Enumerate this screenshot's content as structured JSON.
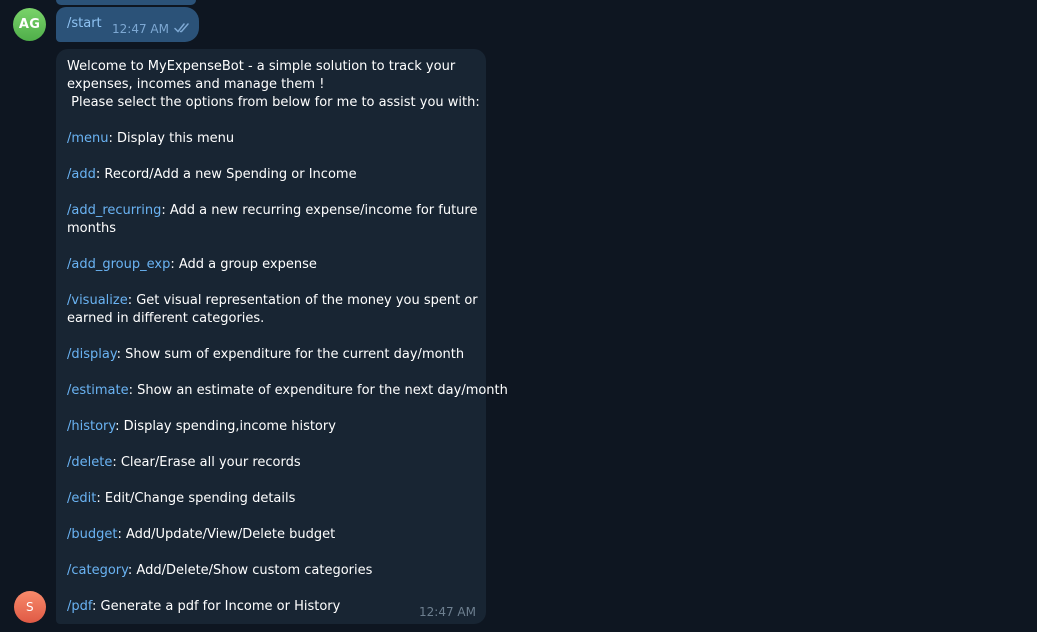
{
  "user_message": {
    "avatar_initials": "AG",
    "command": "/start",
    "time": "12:47 AM",
    "status_icon": "double-check-icon"
  },
  "bot_message": {
    "avatar_initials": "S",
    "intro_lines": [
      "Welcome to MyExpenseBot - a simple solution to track your",
      "expenses, incomes and manage them !",
      " Please select the options from below for me to assist you with:"
    ],
    "commands": [
      {
        "cmd": "/menu",
        "desc_lines": [
          ": Display this menu"
        ]
      },
      {
        "cmd": "/add",
        "desc_lines": [
          ": Record/Add a new Spending or Income"
        ]
      },
      {
        "cmd": "/add_recurring",
        "desc_lines": [
          ": Add a new recurring expense/income for future",
          "months"
        ]
      },
      {
        "cmd": "/add_group_exp",
        "desc_lines": [
          ": Add a group expense"
        ]
      },
      {
        "cmd": "/visualize",
        "desc_lines": [
          ": Get visual representation of the money you spent or",
          "earned in different categories."
        ]
      },
      {
        "cmd": "/display",
        "desc_lines": [
          ": Show sum of expenditure for the current day/month"
        ]
      },
      {
        "cmd": "/estimate",
        "desc_lines": [
          ": Show an estimate of expenditure for the next day/month"
        ]
      },
      {
        "cmd": "/history",
        "desc_lines": [
          ": Display spending,income history"
        ]
      },
      {
        "cmd": "/delete",
        "desc_lines": [
          ": Clear/Erase all your records"
        ]
      },
      {
        "cmd": "/edit",
        "desc_lines": [
          ": Edit/Change spending details"
        ]
      },
      {
        "cmd": "/budget",
        "desc_lines": [
          ": Add/Update/View/Delete budget"
        ]
      },
      {
        "cmd": "/category",
        "desc_lines": [
          ": Add/Delete/Show custom categories"
        ]
      },
      {
        "cmd": "/pdf",
        "desc_lines": [
          ": Generate a pdf for Income or History"
        ]
      }
    ],
    "time": "12:47 AM"
  },
  "colors": {
    "background": "#0e1621",
    "outgoing_bubble": "#2b5278",
    "incoming_bubble": "#182533",
    "link": "#6ab3f3",
    "avatar_ag": "#5fbd55",
    "avatar_s": "#ec6e55"
  }
}
